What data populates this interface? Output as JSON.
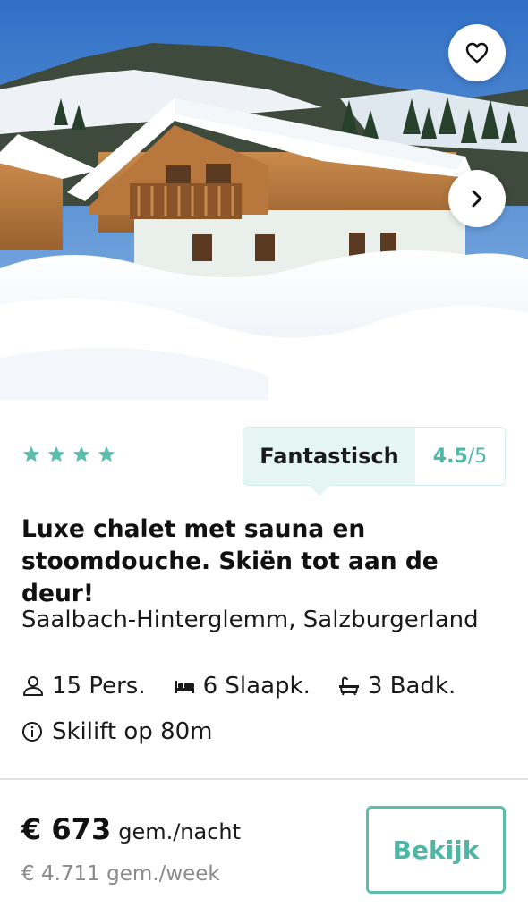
{
  "listing": {
    "image_alt": "",
    "favorite_icon": "heart-outline-icon",
    "next_icon": "chevron-right-icon",
    "stars": 4,
    "star_color": "#5cbfad",
    "rating": {
      "label": "Fantastisch",
      "score": "4.5",
      "max": "/5"
    },
    "title": "Luxe chalet met sauna en stoomdouche. Skiën tot aan de deur!",
    "location": "Saalbach-Hinterglemm, Salzburgerland",
    "features": [
      {
        "icon": "person-icon",
        "text": "15 Pers."
      },
      {
        "icon": "bed-icon",
        "text": "6 Slaapk."
      },
      {
        "icon": "bathtub-icon",
        "text": "3 Badk."
      }
    ],
    "info": {
      "icon": "info-icon",
      "text": "Skilift op 80m"
    },
    "price": {
      "amount": "€ 673",
      "unit": "gem./nacht",
      "week": "€ 4.711 gem./week"
    },
    "cta_label": "Bekijk",
    "accent_color": "#4fb6a6"
  }
}
